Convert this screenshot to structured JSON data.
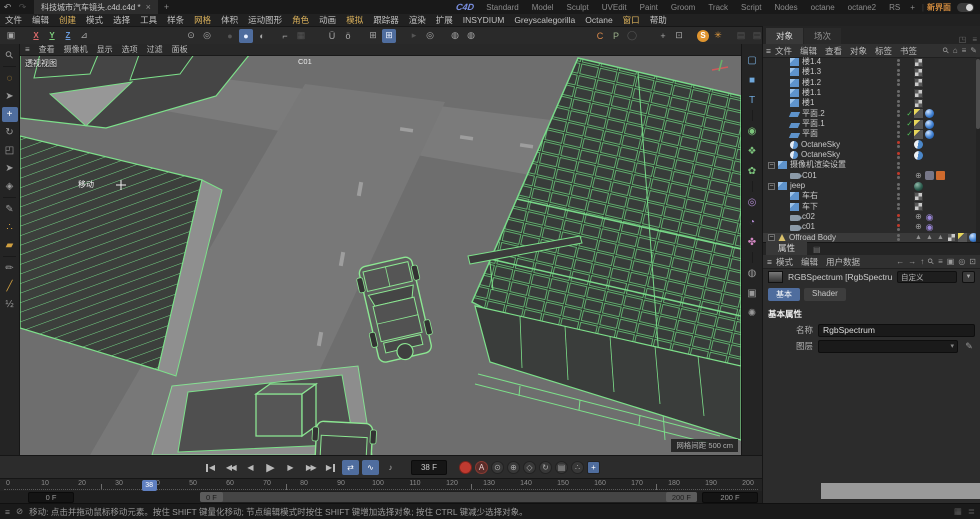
{
  "colors": {
    "accent": "#4f6d9e",
    "wire_green": "#7de08a",
    "menu_highlight": "#d9b05a",
    "octane_orange": "#e0952f",
    "record_red": "#c03a30"
  },
  "titlebar": {
    "undo_glyph": "↶",
    "redo_glyph": "↷",
    "document_tab": "科技城市汽车镜头.c4d.c4d *",
    "close_label": "×",
    "add_tab_label": "+",
    "logo": "C4D",
    "layouts": [
      "Standard",
      "Model",
      "Sculpt",
      "UVEdit",
      "Paint",
      "Groom",
      "Track",
      "Script",
      "Nodes",
      "octane",
      "octane2",
      "RS"
    ],
    "add_layout_label": "+",
    "divider": "|",
    "new_ui_label": "新界面"
  },
  "menubar": {
    "items": [
      {
        "label": "文件",
        "highlight": false
      },
      {
        "label": "编辑",
        "highlight": false
      },
      {
        "label": "创建",
        "highlight": true
      },
      {
        "label": "模式",
        "highlight": false
      },
      {
        "label": "选择",
        "highlight": false
      },
      {
        "label": "工具",
        "highlight": false
      },
      {
        "label": "样条",
        "highlight": false
      },
      {
        "label": "网格",
        "highlight": true
      },
      {
        "label": "体积",
        "highlight": false
      },
      {
        "label": "运动图形",
        "highlight": false
      },
      {
        "label": "角色",
        "highlight": true
      },
      {
        "label": "动画",
        "highlight": false
      },
      {
        "label": "模拟",
        "highlight": true
      },
      {
        "label": "跟踪器",
        "highlight": false
      },
      {
        "label": "渲染",
        "highlight": false
      },
      {
        "label": "扩展",
        "highlight": false
      },
      {
        "label": "INSYDIUM",
        "highlight": false
      },
      {
        "label": "Greyscalegorilla",
        "highlight": false
      },
      {
        "label": "Octane",
        "highlight": false
      },
      {
        "label": "窗口",
        "highlight": true
      },
      {
        "label": "帮助",
        "highlight": false
      }
    ]
  },
  "toolbar": {
    "groups": [
      {
        "ml": 4,
        "icons": [
          {
            "name": "content-browser-icon",
            "glyph": "▣"
          }
        ]
      },
      {
        "ml": 4,
        "icons": [
          {
            "name": "lock-x-axis-icon",
            "glyph": "X",
            "color": "#d96a6a",
            "cls": "ul"
          },
          {
            "name": "lock-y-axis-icon",
            "glyph": "Y",
            "color": "#7ed07e",
            "cls": "ul"
          },
          {
            "name": "lock-z-axis-icon",
            "glyph": "Z",
            "color": "#6a9ad9",
            "cls": "ul"
          },
          {
            "name": "coord-system-icon",
            "glyph": "⊿"
          }
        ]
      },
      {
        "ml": 86,
        "icons": [
          {
            "name": "view-solo-icon",
            "glyph": "⊙"
          },
          {
            "name": "isolate-icon",
            "glyph": "◎"
          }
        ]
      },
      {
        "ml": 2,
        "icons": [
          {
            "name": "shading-a-icon",
            "glyph": "●",
            "dim": true
          },
          {
            "name": "shading-b-icon",
            "glyph": "●",
            "active": true
          },
          {
            "name": "shading-c-icon",
            "glyph": "◐"
          }
        ]
      },
      {
        "ml": 2,
        "icons": [
          {
            "name": "workplane-icon",
            "glyph": "⌐"
          },
          {
            "name": "grid-icon",
            "glyph": "▦",
            "dim": true
          }
        ]
      },
      {
        "ml": 10,
        "icons": [
          {
            "name": "snap-vertex-icon",
            "glyph": "Ü"
          },
          {
            "name": "snap-edge-icon",
            "glyph": "ö"
          }
        ]
      },
      {
        "ml": 4,
        "icons": [
          {
            "name": "quantize-icon",
            "glyph": "⊞"
          },
          {
            "name": "workplane-snap-icon",
            "glyph": "⊞",
            "active": true
          }
        ]
      },
      {
        "ml": 4,
        "icons": [
          {
            "name": "play-tool-icon",
            "glyph": "▸",
            "dim": true
          },
          {
            "name": "target-tool-icon",
            "glyph": "◎"
          }
        ]
      },
      {
        "ml": 4,
        "icons": [
          {
            "name": "sim-a-icon",
            "glyph": "◍"
          },
          {
            "name": "sim-b-icon",
            "glyph": "◍"
          }
        ]
      },
      {
        "ml": 108,
        "icons": [
          {
            "name": "c-mode-icon",
            "glyph": "C",
            "color": "#d9884a"
          },
          {
            "name": "p-mode-icon",
            "glyph": "P",
            "color": "#9ab08a"
          },
          {
            "name": "dim-circle-icon",
            "glyph": "◯",
            "dim": true
          }
        ]
      },
      {
        "ml": 10,
        "icons": [
          {
            "name": "maximize-view-icon",
            "glyph": "+"
          },
          {
            "name": "detach-view-icon",
            "glyph": "⊡"
          }
        ]
      },
      {
        "ml": 4,
        "icons": [
          {
            "name": "octane-live-viewer-icon",
            "glyph": "S",
            "cls": "scircle"
          },
          {
            "name": "octane-node-icon",
            "glyph": "✳",
            "color": "#e09a3e"
          }
        ]
      },
      {
        "ml": 2,
        "icons": [
          {
            "name": "render-view-icon",
            "glyph": "▤",
            "dim": true
          },
          {
            "name": "render-picture-viewer-icon",
            "glyph": "▤",
            "dim": true
          },
          {
            "name": "render-settings-icon",
            "glyph": "▤",
            "dim": true
          }
        ]
      },
      {
        "ml": 2,
        "icons": [
          {
            "name": "octane-logo-icon",
            "glyph": "◯"
          }
        ]
      }
    ]
  },
  "left_toolbar": [
    {
      "name": "viewport-search-icon",
      "glyph": "⚲",
      "cls": "rot45"
    },
    {
      "sep": true
    },
    {
      "name": "live-selection-icon",
      "glyph": "◌",
      "color": "#d0a040"
    },
    {
      "name": "selection-tool-icon",
      "glyph": "➤"
    },
    {
      "name": "move-tool-icon",
      "glyph": "+",
      "active": true
    },
    {
      "name": "rotate-tool-icon",
      "glyph": "↻"
    },
    {
      "name": "scale-tool-icon",
      "glyph": "◰"
    },
    {
      "name": "tweak-tool-icon",
      "glyph": "➤",
      "dim": true
    },
    {
      "name": "transform-tool-icon",
      "glyph": "◈"
    },
    {
      "sep": true
    },
    {
      "name": "spline-pen-icon",
      "glyph": "✎"
    },
    {
      "name": "point-paint-icon",
      "glyph": "∴",
      "color": "#d0a040"
    },
    {
      "name": "polygon-pen-icon",
      "glyph": "▰",
      "color": "#d0a040"
    },
    {
      "sep": true
    },
    {
      "name": "brush-icon",
      "glyph": "✏"
    },
    {
      "name": "knife-icon",
      "glyph": "╱",
      "color": "#d0a040"
    },
    {
      "name": "measure-icon",
      "glyph": "½"
    }
  ],
  "palette": [
    {
      "name": "spline-primitive-icon",
      "glyph": "▢",
      "color": "#7ab0e0"
    },
    {
      "name": "primitive-cube-icon",
      "glyph": "■",
      "color": "#6fa8dc"
    },
    {
      "name": "motext-icon",
      "glyph": "T",
      "color": "#6fa8dc"
    },
    {
      "sep": true
    },
    {
      "name": "subdivision-surface-icon",
      "glyph": "◉",
      "color": "#7cc47c"
    },
    {
      "name": "cloner-icon",
      "glyph": "❖",
      "color": "#7cc47c"
    },
    {
      "name": "deformer-icon",
      "glyph": "✿",
      "color": "#7cc47c"
    },
    {
      "sep": true
    },
    {
      "name": "field-icon",
      "glyph": "◎",
      "color": "#b08ad0"
    },
    {
      "name": "protractor-icon",
      "glyph": "◔",
      "color": "#b08ad0"
    },
    {
      "name": "character-icon",
      "glyph": "✤",
      "color": "#d085c0"
    },
    {
      "sep": true
    },
    {
      "name": "sky-environment-icon",
      "glyph": "◍",
      "color": "#9a9a9a"
    },
    {
      "name": "camera-create-icon",
      "glyph": "▣",
      "color": "#9a9a9a"
    },
    {
      "name": "light-create-icon",
      "glyph": "✺",
      "color": "#9a9a9a"
    }
  ],
  "viewport": {
    "menu": [
      "查看",
      "摄像机",
      "显示",
      "选项",
      "过滤",
      "面板"
    ],
    "menu_icon": "≡",
    "view_label": "透视视图",
    "camera_label": "C01",
    "tool_hint": "移动",
    "grid_info": "网格间距 500 cm"
  },
  "object_manager": {
    "tabs": [
      {
        "label": "对象",
        "active": true
      },
      {
        "label": "场次",
        "active": false
      }
    ],
    "tab_icons": [
      {
        "name": "pin-icon",
        "glyph": "◳"
      },
      {
        "name": "panel-menu-icon",
        "glyph": "≡"
      }
    ],
    "menu": [
      "文件",
      "编辑",
      "查看",
      "对象",
      "标签",
      "书签"
    ],
    "menu_icon": "≡",
    "header_icons": [
      {
        "name": "search-icon",
        "glyph": "⚲",
        "cls": "rot45"
      },
      {
        "name": "home-icon",
        "glyph": "⌂"
      },
      {
        "name": "filter-icon",
        "glyph": "≡"
      },
      {
        "name": "edit-icon",
        "glyph": "✎"
      }
    ],
    "items": [
      {
        "name": "楼1.4",
        "type": "cube",
        "indent": 1,
        "tags": [
          "texture"
        ]
      },
      {
        "name": "楼1.3",
        "type": "cube",
        "indent": 1,
        "tags": [
          "texture"
        ]
      },
      {
        "name": "楼1.2",
        "type": "cube",
        "indent": 1,
        "tags": [
          "texture"
        ]
      },
      {
        "name": "楼1.1",
        "type": "cube",
        "indent": 1,
        "tags": [
          "texture"
        ]
      },
      {
        "name": "楼1",
        "type": "cube",
        "indent": 1,
        "tags": [
          "texture"
        ]
      },
      {
        "name": "平面.2",
        "type": "plane",
        "indent": 1,
        "check": true,
        "tags": [
          "polygon",
          "mat"
        ]
      },
      {
        "name": "平面.1",
        "type": "plane",
        "indent": 1,
        "check": true,
        "tags": [
          "polygon",
          "mat"
        ]
      },
      {
        "name": "平面",
        "type": "plane",
        "indent": 1,
        "check": true,
        "tags": [
          "polygon",
          "mat"
        ]
      },
      {
        "name": "OctaneSky",
        "type": "sky",
        "indent": 1,
        "dots": "red",
        "tags": [
          "sky"
        ]
      },
      {
        "name": "OctaneSky",
        "type": "sky",
        "indent": 1,
        "dots": "red",
        "tags": [
          "sky"
        ]
      },
      {
        "name": "摄像机渲染设置",
        "type": "null",
        "indent": 0,
        "exp": true,
        "tags": []
      },
      {
        "name": "C01",
        "type": "camera",
        "indent": 1,
        "dots": "red",
        "tags": [
          "target",
          "cameratag",
          "orange"
        ]
      },
      {
        "name": "jeep",
        "type": "null",
        "indent": 0,
        "exp": true,
        "tags": [
          "matdark"
        ]
      },
      {
        "name": "车右",
        "type": "cube",
        "indent": 1,
        "tags": [
          "texture"
        ]
      },
      {
        "name": "车下",
        "type": "cube",
        "indent": 1,
        "tags": [
          "texture"
        ]
      },
      {
        "name": "c02",
        "type": "camera",
        "indent": 1,
        "dots": "red",
        "tags": [
          "target",
          "eye"
        ]
      },
      {
        "name": "c01",
        "type": "camera",
        "indent": 1,
        "dots": "red",
        "tags": [
          "target",
          "eye"
        ]
      },
      {
        "name": "Offroad Body",
        "type": "polygon",
        "indent": 0,
        "exp": true,
        "selected": true,
        "tags": [
          "tri",
          "tri",
          "tri",
          "texture",
          "polygon",
          "mat"
        ]
      }
    ]
  },
  "attributes": {
    "tab_label": "属性",
    "tab2_glyph": "▤",
    "menu": [
      "模式",
      "编辑",
      "用户数据"
    ],
    "menu_icon": "≡",
    "header_icons": [
      {
        "name": "back-arrow-icon",
        "glyph": "←"
      },
      {
        "name": "forward-arrow-icon",
        "glyph": "→",
        "dim": true
      },
      {
        "name": "up-arrow-icon",
        "glyph": "↑"
      },
      {
        "name": "search-icon",
        "glyph": "⚲",
        "cls": "rot45"
      },
      {
        "name": "filter-icon",
        "glyph": "≡"
      },
      {
        "name": "lock-icon",
        "glyph": "▣"
      },
      {
        "name": "focus-icon",
        "glyph": "◎"
      },
      {
        "name": "new-window-icon",
        "glyph": "⊡"
      }
    ],
    "object_title": "RGBSpectrum [RgbSpectrum]",
    "preset_label": "自定义",
    "preset_caret": "▼",
    "mode_tabs": [
      {
        "label": "基本",
        "active": true
      },
      {
        "label": "Shader",
        "active": false
      }
    ],
    "section_title": "基本属性",
    "fields": [
      {
        "label": "名称",
        "value": "RgbSpectrum"
      },
      {
        "label": "图层",
        "value": ""
      }
    ],
    "pencil_glyph": "✎"
  },
  "timeline": {
    "transport": [
      {
        "name": "goto-start-button",
        "glyph": "◀",
        "cls": "bar-l"
      },
      {
        "name": "prev-key-button",
        "glyph": "◀◀",
        "cls": "dbl"
      },
      {
        "name": "prev-frame-button",
        "glyph": "◀"
      },
      {
        "name": "play-button",
        "glyph": "▶",
        "cls": "big"
      },
      {
        "name": "next-frame-button",
        "glyph": "▶"
      },
      {
        "name": "next-key-button",
        "glyph": "▶▶",
        "cls": "dbl"
      },
      {
        "name": "goto-end-button",
        "glyph": "▶",
        "cls": "bar-r"
      },
      {
        "name": "loop-toggle",
        "glyph": "⇄",
        "cls": "on"
      },
      {
        "name": "ramp-toggle",
        "glyph": "∿",
        "cls": "on"
      },
      {
        "name": "sound-toggle",
        "glyph": "♪"
      }
    ],
    "frame_field": "38 F",
    "record": [
      {
        "name": "record-keyframe-button",
        "glyph": "",
        "cls": "rec"
      },
      {
        "name": "autokey-button",
        "glyph": "A",
        "cls": "akey"
      },
      {
        "name": "keyframe-selection-button",
        "glyph": "⊙"
      },
      {
        "name": "record-position-toggle",
        "glyph": "⊕"
      },
      {
        "name": "record-scale-toggle",
        "glyph": "◇"
      },
      {
        "name": "record-rotation-toggle",
        "glyph": "↻"
      },
      {
        "name": "record-parameter-toggle",
        "glyph": "▤"
      },
      {
        "name": "record-pla-toggle",
        "glyph": "∴"
      },
      {
        "name": "snap-toggle",
        "glyph": "+",
        "cls": "on"
      }
    ],
    "playhead_label": "38",
    "playhead_frame": 38,
    "ruler_start": 0,
    "ruler_end": 200,
    "ruler_step": 10,
    "tick_step": 25,
    "range_start_field": "0 F",
    "range_start_label": "0 F",
    "range_end_label": "200 F",
    "range_end_field": "200 F"
  },
  "statusbar": {
    "menu_icon": "≡",
    "ok_icon": "⊘",
    "message": "移动: 点击并拖动鼠标移动元素。按住 SHIFT 键量化移动; 节点编辑模式时按住 SHIFT 键增加选择对象; 按住 CTRL 键减少选择对象。",
    "right_icons": [
      {
        "name": "layout-grid-icon",
        "glyph": "▦"
      },
      {
        "name": "console-icon",
        "glyph": "≣"
      }
    ]
  }
}
